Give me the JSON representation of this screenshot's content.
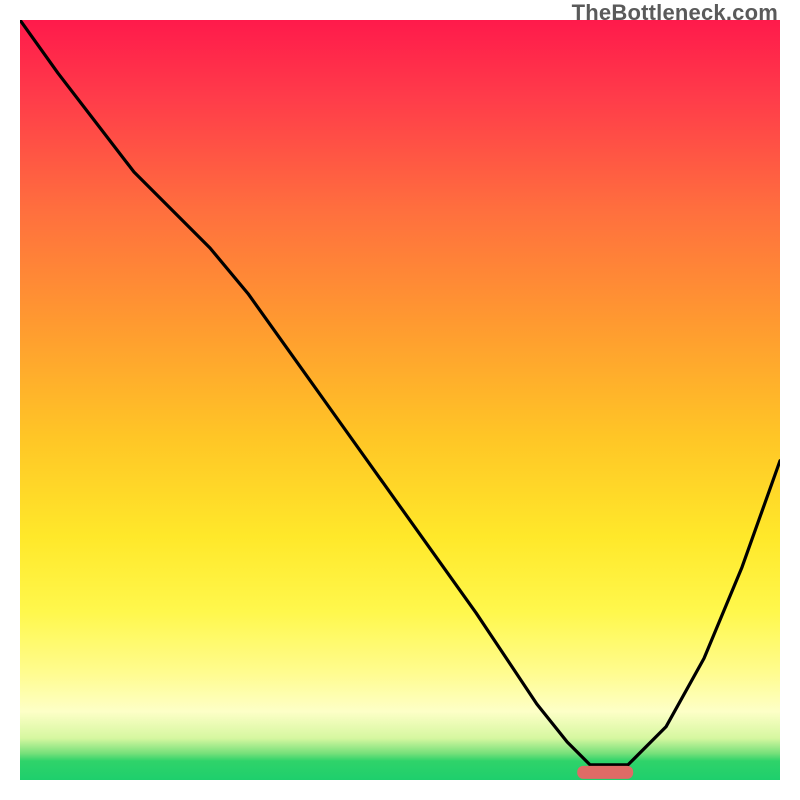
{
  "watermark": "TheBottleneck.com",
  "chart_data": {
    "type": "line",
    "title": "",
    "xlabel": "",
    "ylabel": "",
    "xlim": [
      0,
      100
    ],
    "ylim": [
      0,
      100
    ],
    "grid": false,
    "legend": false,
    "annotations": [
      {
        "type": "marker",
        "shape": "rounded-bar",
        "x": 77,
        "y": 1,
        "color": "#df6b66"
      }
    ],
    "series": [
      {
        "name": "bottleneck-curve",
        "color": "#000000",
        "x": [
          0,
          5,
          15,
          25,
          30,
          40,
          50,
          60,
          68,
          72,
          75,
          80,
          85,
          90,
          95,
          100
        ],
        "y": [
          100,
          93,
          80,
          70,
          64,
          50,
          36,
          22,
          10,
          5,
          2,
          2,
          7,
          16,
          28,
          42
        ]
      }
    ],
    "background_gradient": {
      "top": "#ff1a4b",
      "upper_mid": "#ff9a30",
      "mid": "#ffe82a",
      "lower_mid": "#fdffc7",
      "bottom": "#1ecf6c"
    }
  }
}
